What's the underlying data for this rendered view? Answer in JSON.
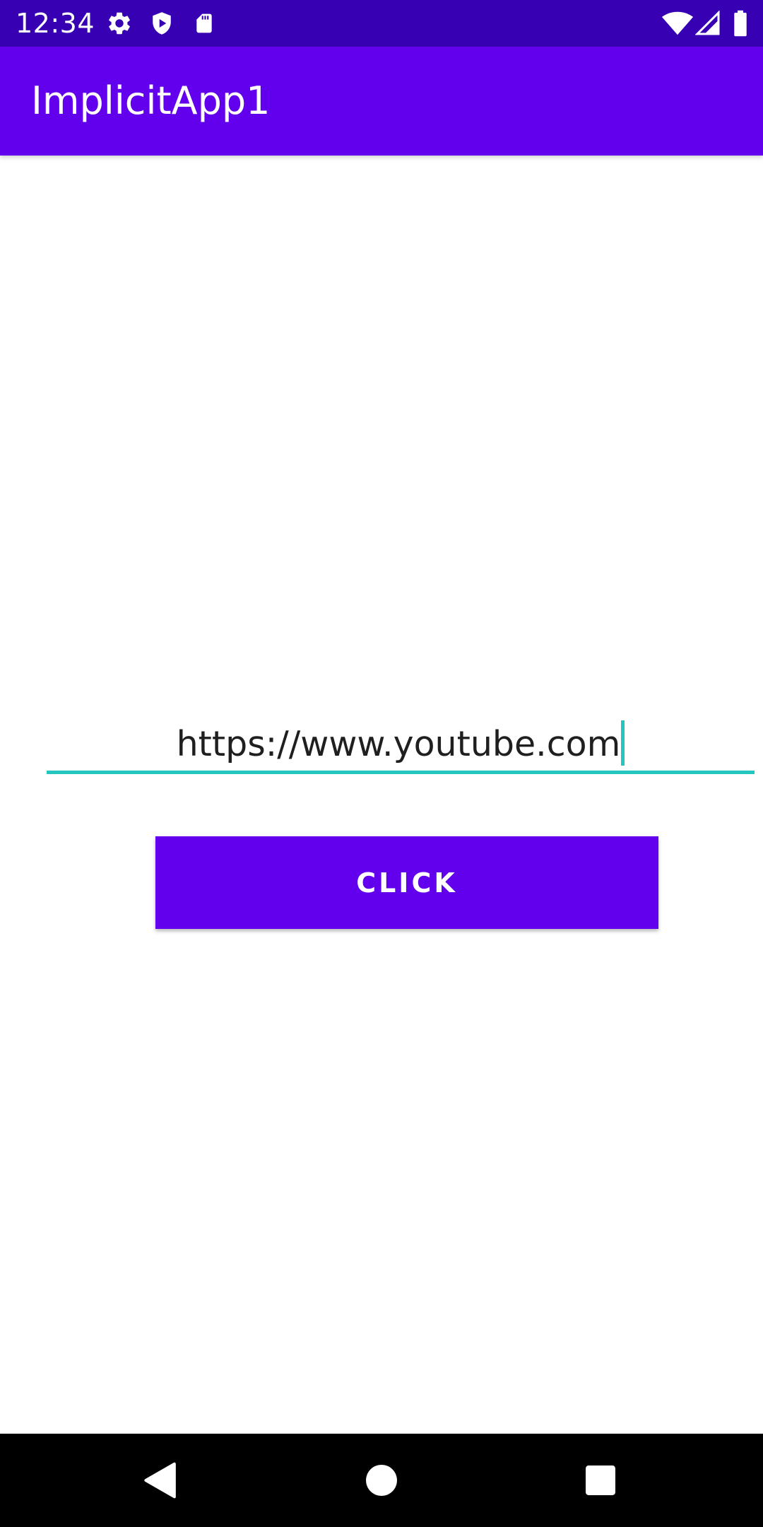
{
  "status_bar": {
    "time": "12:34",
    "left_icons": [
      "gear-icon",
      "shield-play-icon",
      "sd-card-icon"
    ],
    "right_icons": [
      "wifi-icon",
      "cell-signal-icon",
      "battery-icon"
    ],
    "background": "#3700b3"
  },
  "app_bar": {
    "title": "ImplicitApp1",
    "background": "#6200ee"
  },
  "url_field": {
    "value": "https://www.youtube.com",
    "accent": "#26c6c0"
  },
  "button": {
    "label": "CLICK",
    "background": "#6200ee"
  },
  "nav_bar": {
    "buttons": [
      "back-icon",
      "home-icon",
      "recents-icon"
    ]
  }
}
